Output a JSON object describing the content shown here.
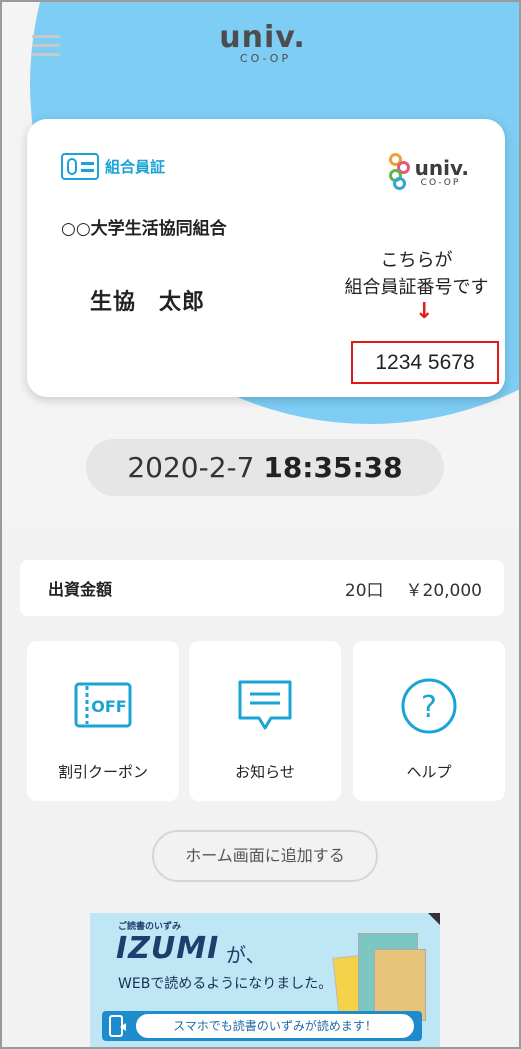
{
  "header": {
    "logo_main": "univ.",
    "logo_sub": "CO-OP"
  },
  "card": {
    "badge_label": "組合員証",
    "logo_main": "univ.",
    "logo_sub": "CO-OP",
    "organization": "○○大学生活協同組合",
    "member_name": "生協　太郎",
    "annotation_line1": "こちらが",
    "annotation_line2": "組合員証番号です",
    "arrow": "↓",
    "member_number": "1234 5678"
  },
  "datetime": {
    "date": "2020-2-7",
    "time": "18:35:38"
  },
  "investment": {
    "label": "出資金額",
    "units": "20口",
    "amount": "￥20,000"
  },
  "tiles": [
    {
      "label": "割引クーポン",
      "icon": "coupon-off-icon",
      "icon_text": "OFF"
    },
    {
      "label": "お知らせ",
      "icon": "notice-speech-bubble-icon"
    },
    {
      "label": "ヘルプ",
      "icon": "help-question-icon",
      "icon_text": "?"
    }
  ],
  "add_home_button": "ホーム画面に追加する",
  "banner": {
    "small_title": "ご読書のいずみ",
    "brand": "IZUMI",
    "ga": "が、",
    "readable_text": "WEBで読めるようになりました。",
    "strip_text": "スマホでも読書のいずみが読めます！"
  },
  "colors": {
    "accent_blue": "#1aa4d6",
    "circle_blue": "#7dcdf4",
    "highlight_red": "#e01a1a"
  }
}
